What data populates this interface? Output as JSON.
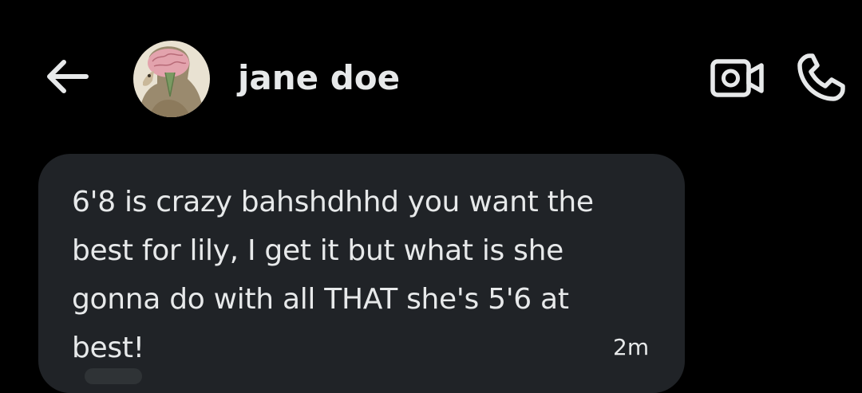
{
  "header": {
    "back_icon": "arrow-left-icon",
    "contact_name": "jane doe",
    "avatar_icon": "profile-avatar",
    "video_icon": "video-camera-icon",
    "call_icon": "phone-icon"
  },
  "conversation": {
    "messages": [
      {
        "text": "6'8 is crazy bahshdhhd you want the best for lily, I get it but what is she gonna do with all THAT she's 5'6 at best!",
        "time": "2m"
      }
    ]
  },
  "colors": {
    "background": "#000000",
    "bubble": "#202327",
    "text": "#e7e9ea"
  }
}
